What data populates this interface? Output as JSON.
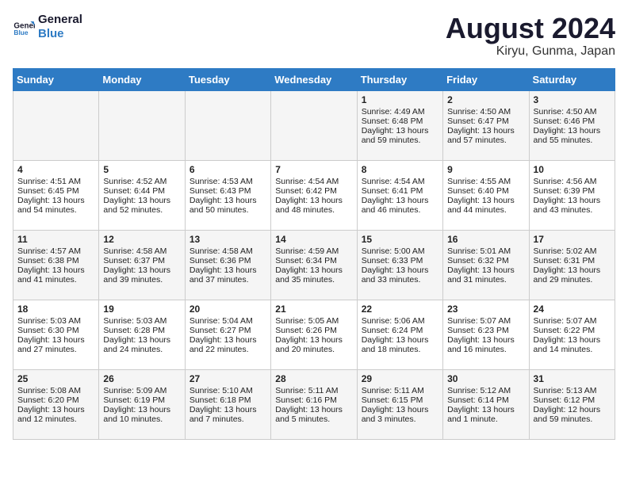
{
  "header": {
    "logo_line1": "General",
    "logo_line2": "Blue",
    "month_title": "August 2024",
    "location": "Kiryu, Gunma, Japan"
  },
  "weekdays": [
    "Sunday",
    "Monday",
    "Tuesday",
    "Wednesday",
    "Thursday",
    "Friday",
    "Saturday"
  ],
  "weeks": [
    [
      {
        "day": "",
        "info": ""
      },
      {
        "day": "",
        "info": ""
      },
      {
        "day": "",
        "info": ""
      },
      {
        "day": "",
        "info": ""
      },
      {
        "day": "1",
        "info": "Sunrise: 4:49 AM\nSunset: 6:48 PM\nDaylight: 13 hours\nand 59 minutes."
      },
      {
        "day": "2",
        "info": "Sunrise: 4:50 AM\nSunset: 6:47 PM\nDaylight: 13 hours\nand 57 minutes."
      },
      {
        "day": "3",
        "info": "Sunrise: 4:50 AM\nSunset: 6:46 PM\nDaylight: 13 hours\nand 55 minutes."
      }
    ],
    [
      {
        "day": "4",
        "info": "Sunrise: 4:51 AM\nSunset: 6:45 PM\nDaylight: 13 hours\nand 54 minutes."
      },
      {
        "day": "5",
        "info": "Sunrise: 4:52 AM\nSunset: 6:44 PM\nDaylight: 13 hours\nand 52 minutes."
      },
      {
        "day": "6",
        "info": "Sunrise: 4:53 AM\nSunset: 6:43 PM\nDaylight: 13 hours\nand 50 minutes."
      },
      {
        "day": "7",
        "info": "Sunrise: 4:54 AM\nSunset: 6:42 PM\nDaylight: 13 hours\nand 48 minutes."
      },
      {
        "day": "8",
        "info": "Sunrise: 4:54 AM\nSunset: 6:41 PM\nDaylight: 13 hours\nand 46 minutes."
      },
      {
        "day": "9",
        "info": "Sunrise: 4:55 AM\nSunset: 6:40 PM\nDaylight: 13 hours\nand 44 minutes."
      },
      {
        "day": "10",
        "info": "Sunrise: 4:56 AM\nSunset: 6:39 PM\nDaylight: 13 hours\nand 43 minutes."
      }
    ],
    [
      {
        "day": "11",
        "info": "Sunrise: 4:57 AM\nSunset: 6:38 PM\nDaylight: 13 hours\nand 41 minutes."
      },
      {
        "day": "12",
        "info": "Sunrise: 4:58 AM\nSunset: 6:37 PM\nDaylight: 13 hours\nand 39 minutes."
      },
      {
        "day": "13",
        "info": "Sunrise: 4:58 AM\nSunset: 6:36 PM\nDaylight: 13 hours\nand 37 minutes."
      },
      {
        "day": "14",
        "info": "Sunrise: 4:59 AM\nSunset: 6:34 PM\nDaylight: 13 hours\nand 35 minutes."
      },
      {
        "day": "15",
        "info": "Sunrise: 5:00 AM\nSunset: 6:33 PM\nDaylight: 13 hours\nand 33 minutes."
      },
      {
        "day": "16",
        "info": "Sunrise: 5:01 AM\nSunset: 6:32 PM\nDaylight: 13 hours\nand 31 minutes."
      },
      {
        "day": "17",
        "info": "Sunrise: 5:02 AM\nSunset: 6:31 PM\nDaylight: 13 hours\nand 29 minutes."
      }
    ],
    [
      {
        "day": "18",
        "info": "Sunrise: 5:03 AM\nSunset: 6:30 PM\nDaylight: 13 hours\nand 27 minutes."
      },
      {
        "day": "19",
        "info": "Sunrise: 5:03 AM\nSunset: 6:28 PM\nDaylight: 13 hours\nand 24 minutes."
      },
      {
        "day": "20",
        "info": "Sunrise: 5:04 AM\nSunset: 6:27 PM\nDaylight: 13 hours\nand 22 minutes."
      },
      {
        "day": "21",
        "info": "Sunrise: 5:05 AM\nSunset: 6:26 PM\nDaylight: 13 hours\nand 20 minutes."
      },
      {
        "day": "22",
        "info": "Sunrise: 5:06 AM\nSunset: 6:24 PM\nDaylight: 13 hours\nand 18 minutes."
      },
      {
        "day": "23",
        "info": "Sunrise: 5:07 AM\nSunset: 6:23 PM\nDaylight: 13 hours\nand 16 minutes."
      },
      {
        "day": "24",
        "info": "Sunrise: 5:07 AM\nSunset: 6:22 PM\nDaylight: 13 hours\nand 14 minutes."
      }
    ],
    [
      {
        "day": "25",
        "info": "Sunrise: 5:08 AM\nSunset: 6:20 PM\nDaylight: 13 hours\nand 12 minutes."
      },
      {
        "day": "26",
        "info": "Sunrise: 5:09 AM\nSunset: 6:19 PM\nDaylight: 13 hours\nand 10 minutes."
      },
      {
        "day": "27",
        "info": "Sunrise: 5:10 AM\nSunset: 6:18 PM\nDaylight: 13 hours\nand 7 minutes."
      },
      {
        "day": "28",
        "info": "Sunrise: 5:11 AM\nSunset: 6:16 PM\nDaylight: 13 hours\nand 5 minutes."
      },
      {
        "day": "29",
        "info": "Sunrise: 5:11 AM\nSunset: 6:15 PM\nDaylight: 13 hours\nand 3 minutes."
      },
      {
        "day": "30",
        "info": "Sunrise: 5:12 AM\nSunset: 6:14 PM\nDaylight: 13 hours\nand 1 minute."
      },
      {
        "day": "31",
        "info": "Sunrise: 5:13 AM\nSunset: 6:12 PM\nDaylight: 12 hours\nand 59 minutes."
      }
    ]
  ]
}
